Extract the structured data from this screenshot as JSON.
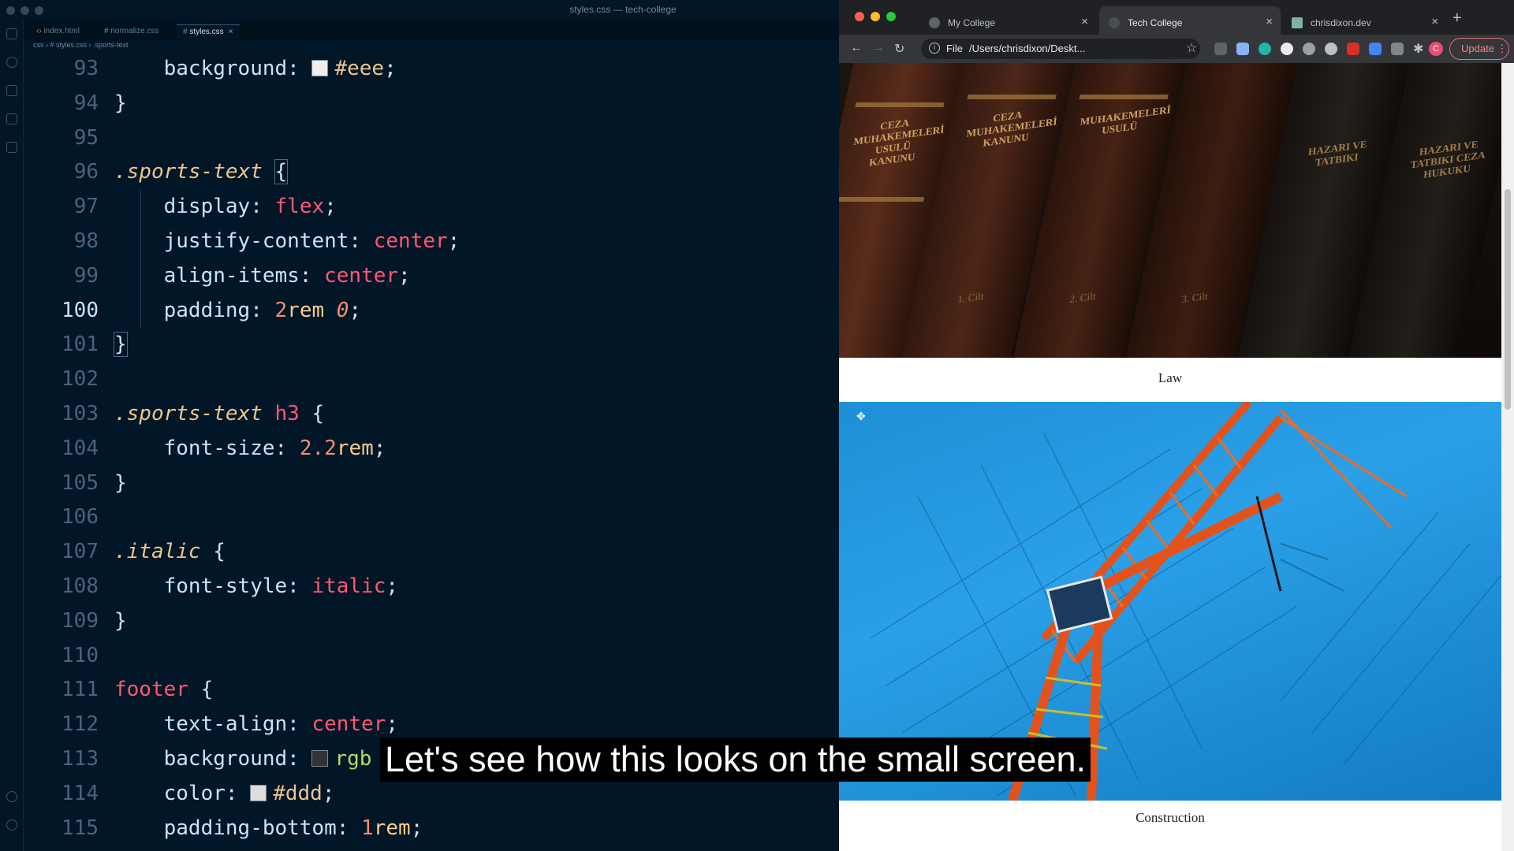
{
  "vscode": {
    "title": "styles.css — tech-college",
    "tabs": [
      {
        "label": "index.html",
        "icon": "html-file-icon"
      },
      {
        "label": "normalize.css",
        "icon": "css-file-icon"
      },
      {
        "label": "styles.css",
        "icon": "css-file-icon",
        "active": true
      }
    ],
    "breadcrumb": [
      "css",
      "# styles.css",
      ".sports-text"
    ],
    "code_lines": [
      {
        "n": "93"
      },
      {
        "n": "94"
      },
      {
        "n": "95"
      },
      {
        "n": "96"
      },
      {
        "n": "97"
      },
      {
        "n": "98"
      },
      {
        "n": "99"
      },
      {
        "n": "100"
      },
      {
        "n": "101"
      },
      {
        "n": "102"
      },
      {
        "n": "103"
      },
      {
        "n": "104"
      },
      {
        "n": "105"
      },
      {
        "n": "106"
      },
      {
        "n": "107"
      },
      {
        "n": "108"
      },
      {
        "n": "109"
      },
      {
        "n": "110"
      },
      {
        "n": "111"
      },
      {
        "n": "112"
      },
      {
        "n": "113"
      },
      {
        "n": "114"
      },
      {
        "n": "115"
      }
    ],
    "tokens": {
      "l93_prop": "background:",
      "l93_val": "#eee",
      "l93_end": ";",
      "l94": "}",
      "l96_sel": ".sports-text",
      "l96_brace": "{",
      "l97_prop": "display:",
      "l97_val": "flex",
      "l97_end": ";",
      "l98_prop": "justify-content:",
      "l98_val": "center",
      "l98_end": ";",
      "l99_prop": "align-items:",
      "l99_val": "center",
      "l99_end": ";",
      "l100_prop": "padding:",
      "l100_num": "2",
      "l100_unit": "rem",
      "l100_zero": "0",
      "l100_end": ";",
      "l101": "}",
      "l103_sel": ".sports-text",
      "l103_tag": "h3",
      "l103_brace": "{",
      "l104_prop": "font-size:",
      "l104_num": "2.2",
      "l104_unit": "rem",
      "l104_end": ";",
      "l105": "}",
      "l107_sel": ".italic",
      "l107_brace": "{",
      "l108_prop": "font-style:",
      "l108_val": "italic",
      "l108_end": ";",
      "l109": "}",
      "l111_tag": "footer",
      "l111_brace": "{",
      "l112_prop": "text-align:",
      "l112_val": "center",
      "l112_end": ";",
      "l113_prop": "background:",
      "l113_fn": "rgb",
      "l114_prop": "color:",
      "l114_val": "#ddd",
      "l114_end": ";",
      "l115_prop": "padding-bottom:",
      "l115_num": "1",
      "l115_unit": "rem",
      "l115_end": ";"
    },
    "swatch_colors": {
      "eee": "#eeeeee",
      "rgb": "#333333",
      "ddd": "#dddddd"
    }
  },
  "browser": {
    "tabs": [
      {
        "label": "My College"
      },
      {
        "label": "Tech College",
        "active": true
      },
      {
        "label": "chrisdixon.dev"
      }
    ],
    "omnibox": {
      "scheme": "File",
      "url": "/Users/chrisdixon/Deskt..."
    },
    "update_label": "Update",
    "profile_initial": "C",
    "cards": [
      {
        "label": "Law"
      },
      {
        "label": "Construction"
      }
    ],
    "book_titles": [
      "CEZA MUHAKEMELERİ USULÜ KANUNU",
      "CEZA MUHAKEMELERİ KANUNU",
      "MUHAKEMELERİ USULÜ",
      "HAZARI VE TATBIKI",
      "HAZARI VE TATBIKI CEZA HUKUKU"
    ],
    "book_volumes": [
      "1. Cilt",
      "2. Cilt",
      "3. Cilt"
    ]
  },
  "caption": "Let's see how this looks on the small screen."
}
